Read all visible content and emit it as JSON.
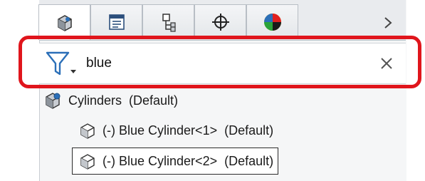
{
  "tabs": [
    {
      "icon": "part-cube-icon",
      "name": "FeatureManager"
    },
    {
      "icon": "property-list-icon",
      "name": "PropertyManager"
    },
    {
      "icon": "configuration-icon",
      "name": "ConfigurationManager"
    },
    {
      "icon": "dimxpert-crosshair-icon",
      "name": "DimXpertManager"
    },
    {
      "icon": "display-color-pie-icon",
      "name": "DisplayManager"
    }
  ],
  "more_tabs_icon": "chevron-right-icon",
  "filter": {
    "icon": "filter-funnel-icon",
    "value": "blue",
    "clear_icon": "close-icon"
  },
  "tree": {
    "root": {
      "name": "Cylinders",
      "config": "(Default)",
      "icon": "assembly-icon"
    },
    "children": [
      {
        "prefix": "(-)",
        "name": "Blue Cylinder<1>",
        "config": "(Default)",
        "icon": "part-icon",
        "selected": false
      },
      {
        "prefix": "(-)",
        "name": "Blue Cylinder<2>",
        "config": "(Default)",
        "icon": "part-icon",
        "selected": true
      }
    ]
  },
  "colors": {
    "highlight": "#e0151c",
    "funnel_blue": "#2b6fb8"
  }
}
